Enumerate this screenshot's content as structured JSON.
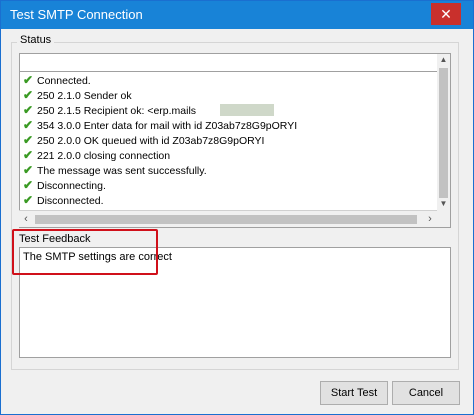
{
  "window": {
    "title": "Test SMTP Connection",
    "close_glyph": "✕"
  },
  "status": {
    "legend": "Status",
    "lines": [
      "Connected.",
      "250 2.1.0 Sender ok",
      "250 2.1.5 Recipient ok: <erp.mails",
      "354 3.0.0 Enter data for mail with id Z03ab7z8G9pORYI",
      "250 2.0.0 OK queued with id Z03ab7z8G9pORYI",
      "221 2.0.0 closing connection",
      "The message was sent successfully.",
      "Disconnecting.",
      "Disconnected."
    ],
    "check_glyph": "✔"
  },
  "feedback": {
    "legend": "Test Feedback",
    "text": "The SMTP settings are correct",
    "highlight_color": "#d0101a"
  },
  "buttons": {
    "start_test": "Start Test",
    "cancel": "Cancel"
  },
  "scroll": {
    "up": "▲",
    "down": "▼",
    "left": "‹",
    "right": "›"
  },
  "colors": {
    "titlebar": "#1883d7",
    "check": "#3a9a23"
  }
}
